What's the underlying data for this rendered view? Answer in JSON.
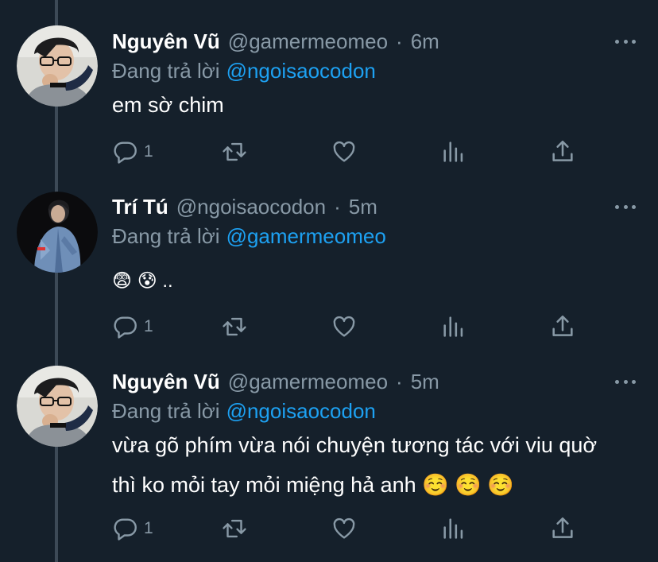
{
  "colors": {
    "background": "#15202b",
    "secondary_text": "#8899a6",
    "link": "#1da1f2",
    "thread_line": "#3d4a57"
  },
  "tweets": [
    {
      "name": "Nguyên Vũ",
      "handle": "@gamermeomeo",
      "time": "6m",
      "reply_prefix": "Đang trả lời",
      "reply_to": "@ngoisaocodon",
      "text_lines": [
        "em sờ chim"
      ],
      "reply_count": "1",
      "avatar_icon": "avatar-nguyen-vu"
    },
    {
      "name": "Trí Tú",
      "handle": "@ngoisaocodon",
      "time": "5m",
      "reply_prefix": "Đang trả lời",
      "reply_to": "@gamermeomeo",
      "text_lines": [
        "😨 😰 .."
      ],
      "reply_count": "1",
      "avatar_icon": "avatar-tri-tu"
    },
    {
      "name": "Nguyên Vũ",
      "handle": "@gamermeomeo",
      "time": "5m",
      "reply_prefix": "Đang trả lời",
      "reply_to": "@ngoisaocodon",
      "text_lines": [
        "vừa gõ phím vừa nói chuyện tương tác với viu quờ",
        "thì ko mỏi tay mỏi miệng hả anh ☺️ ☺️ ☺️"
      ],
      "reply_count": "1",
      "avatar_icon": "avatar-nguyen-vu"
    }
  ],
  "icons": [
    "reply-icon",
    "retweet-icon",
    "like-icon",
    "analytics-icon",
    "share-icon",
    "more-icon"
  ]
}
